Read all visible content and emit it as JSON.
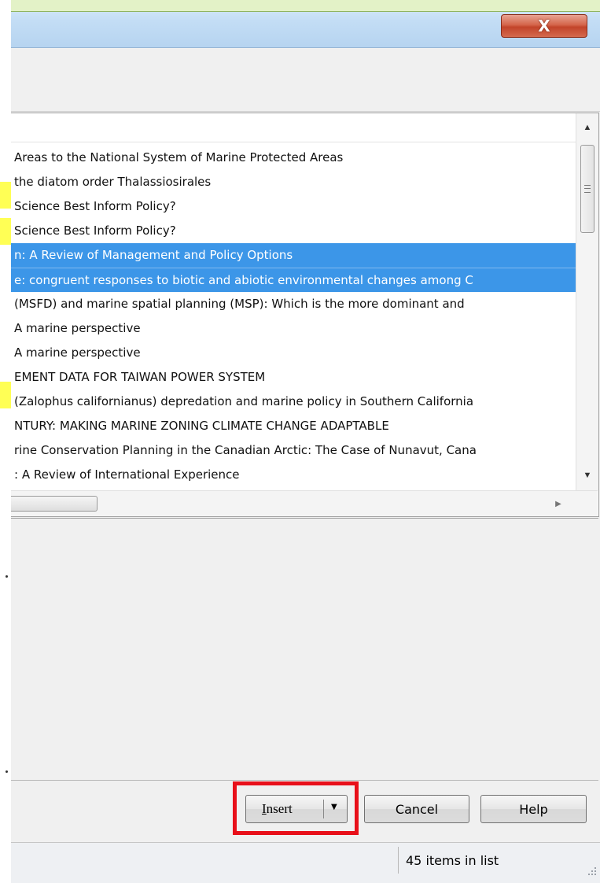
{
  "window": {
    "close_glyph": "X"
  },
  "list": {
    "items": [
      "Areas to the National System of Marine Protected Areas",
      "the diatom order Thalassiosirales",
      "Science Best Inform Policy?",
      "Science Best Inform Policy?",
      "n: A Review of Management and Policy Options",
      "e: congruent responses to biotic and abiotic environmental changes among C",
      "(MSFD) and marine spatial planning (MSP): Which is the more dominant and",
      " A marine perspective",
      " A marine perspective",
      "EMENT DATA FOR TAIWAN POWER SYSTEM",
      "(Zalophus californianus) depredation and marine policy in Southern California",
      "NTURY: MAKING MARINE ZONING CLIMATE CHANGE ADAPTABLE",
      "rine Conservation Planning in the Canadian Arctic: The Case of Nunavut, Cana",
      ": A Review of International Experience"
    ],
    "selected_indices": [
      4,
      5
    ]
  },
  "buttons": {
    "insert_first_letter": "I",
    "insert_rest": "nsert",
    "insert_dropdown": "▼",
    "cancel": "Cancel",
    "help": "Help"
  },
  "status": {
    "item_count": "45 items in list"
  },
  "colors": {
    "selection": "#3c96e8",
    "highlight_box": "#e8101a",
    "close_button": "#c2442a"
  },
  "icons": {
    "close": "close-icon",
    "scroll_up": "arrow-up-icon",
    "scroll_down": "arrow-down-icon",
    "scroll_right": "arrow-right-icon",
    "dropdown": "chevron-down-icon"
  }
}
